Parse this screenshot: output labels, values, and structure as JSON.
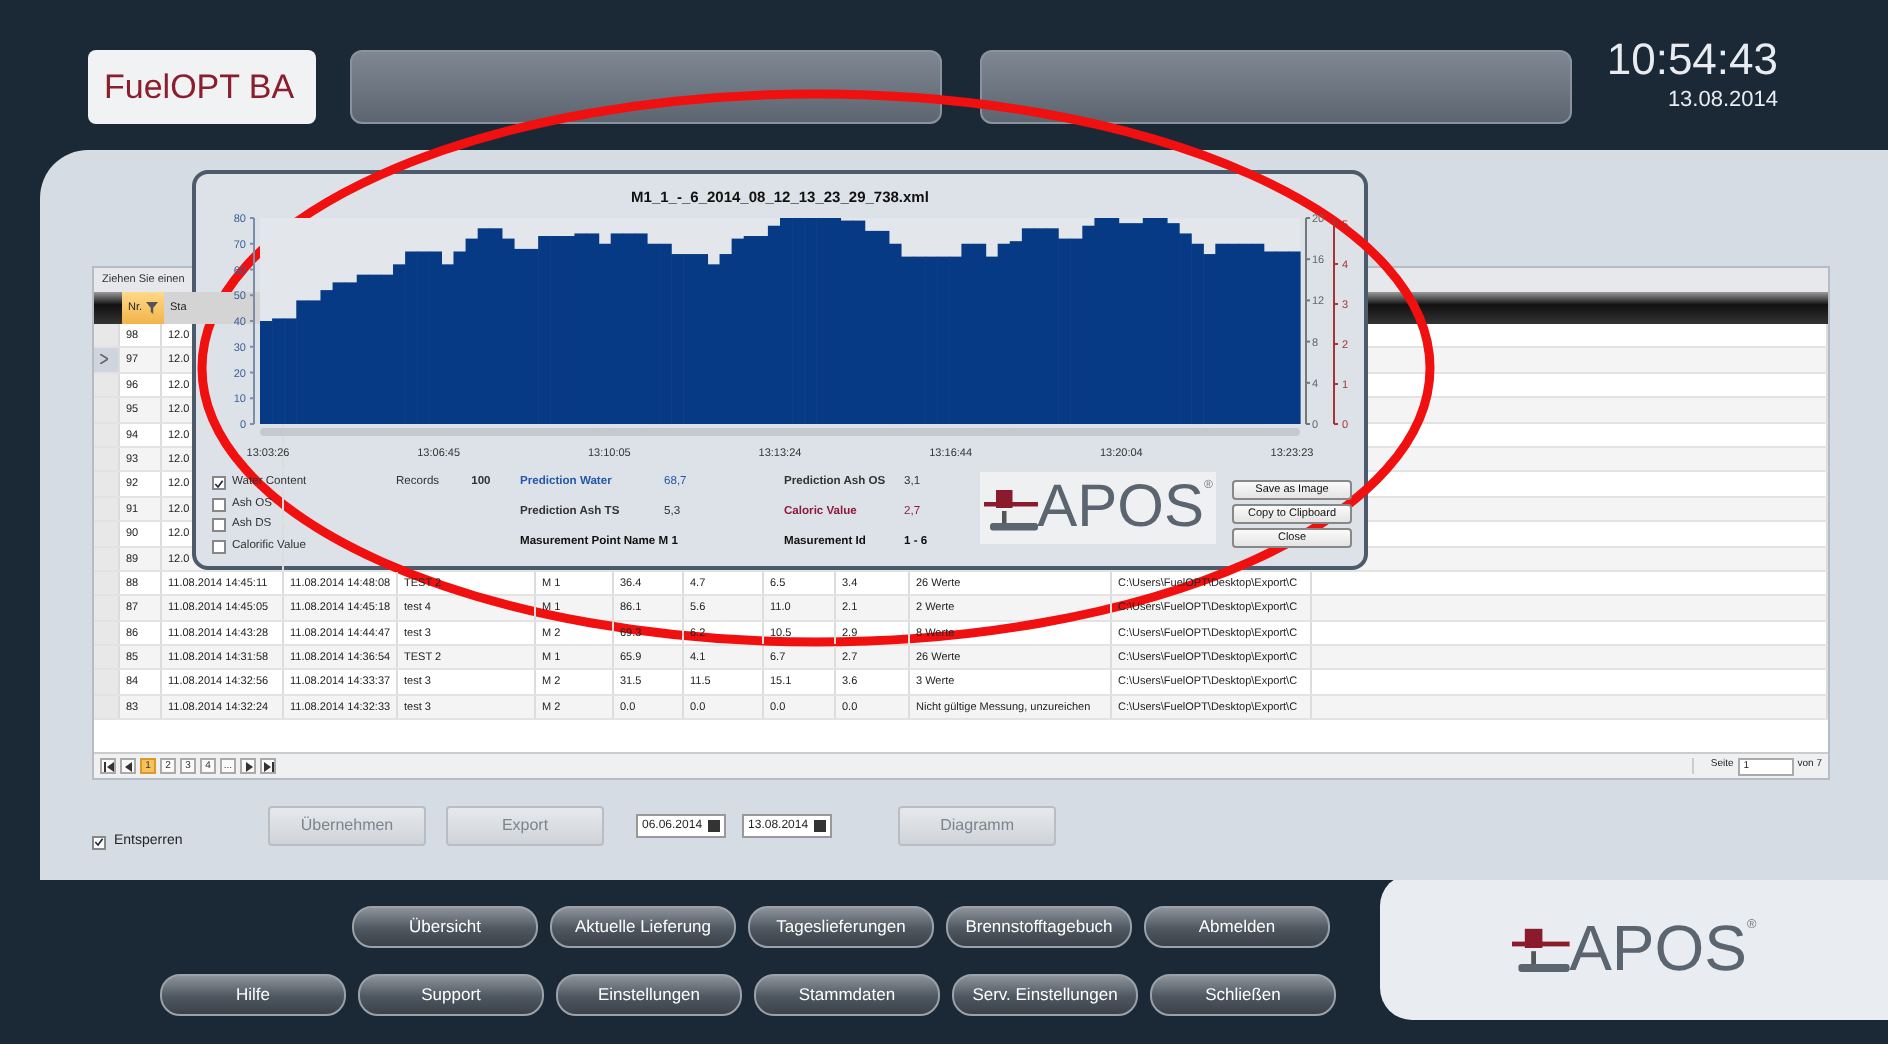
{
  "header": {
    "logo": "FuelOPT BA",
    "time": "10:54:43",
    "date": "13.08.2014"
  },
  "grid": {
    "group_hint": "Ziehen Sie einen",
    "columns": [
      {
        "label": "Nr.",
        "selected": true
      },
      {
        "label": "Sta",
        "selected": false
      }
    ],
    "rows": [
      {
        "selected": false,
        "cells": [
          "98",
          "12.0"
        ]
      },
      {
        "selected": true,
        "cells": [
          "97",
          "12.0"
        ]
      },
      {
        "selected": false,
        "cells": [
          "96",
          "12.0"
        ]
      },
      {
        "selected": false,
        "cells": [
          "95",
          "12.0"
        ]
      },
      {
        "selected": false,
        "cells": [
          "94",
          "12.0"
        ]
      },
      {
        "selected": false,
        "cells": [
          "93",
          "12.0"
        ]
      },
      {
        "selected": false,
        "cells": [
          "92",
          "12.0"
        ]
      },
      {
        "selected": false,
        "cells": [
          "91",
          "12.0"
        ]
      },
      {
        "selected": false,
        "cells": [
          "90",
          "12.0"
        ]
      },
      {
        "selected": false,
        "cells": [
          "89",
          "12.0"
        ]
      },
      {
        "selected": false,
        "cells": [
          "88",
          "11.08.2014 14:45:11",
          "11.08.2014 14:48:08",
          "TEST 2",
          "M 1",
          "36.4",
          "4.7",
          "6.5",
          "3.4",
          "26 Werte",
          "C:\\Users\\FuelOPT\\Desktop\\Export\\C"
        ]
      },
      {
        "selected": false,
        "cells": [
          "87",
          "11.08.2014 14:45:05",
          "11.08.2014 14:45:18",
          "test 4",
          "M 1",
          "86.1",
          "5.6",
          "11.0",
          "2.1",
          "2 Werte",
          "C:\\Users\\FuelOPT\\Desktop\\Export\\C"
        ]
      },
      {
        "selected": false,
        "cells": [
          "86",
          "11.08.2014 14:43:28",
          "11.08.2014 14:44:47",
          "test 3",
          "M 2",
          "69.3",
          "6.2",
          "10.5",
          "2.9",
          "8 Werte",
          "C:\\Users\\FuelOPT\\Desktop\\Export\\C"
        ]
      },
      {
        "selected": false,
        "cells": [
          "85",
          "11.08.2014 14:31:58",
          "11.08.2014 14:36:54",
          "TEST 2",
          "M 1",
          "65.9",
          "4.1",
          "6.7",
          "2.7",
          "26 Werte",
          "C:\\Users\\FuelOPT\\Desktop\\Export\\C"
        ]
      },
      {
        "selected": false,
        "cells": [
          "84",
          "11.08.2014 14:32:56",
          "11.08.2014 14:33:37",
          "test 3",
          "M 2",
          "31.5",
          "11.5",
          "15.1",
          "3.6",
          "3 Werte",
          "C:\\Users\\FuelOPT\\Desktop\\Export\\C"
        ]
      },
      {
        "selected": false,
        "cells": [
          "83",
          "11.08.2014 14:32:24",
          "11.08.2014 14:32:33",
          "test 3",
          "M 2",
          "0.0",
          "0.0",
          "0.0",
          "0.0",
          "Nicht gültige Messung, unzureichen",
          "C:\\Users\\FuelOPT\\Desktop\\Export\\C"
        ]
      }
    ]
  },
  "pager": {
    "pages": [
      {
        "label": "1",
        "selected": true
      },
      {
        "label": "2",
        "selected": false
      },
      {
        "label": "3",
        "selected": false
      },
      {
        "label": "4",
        "selected": false
      },
      {
        "label": "...",
        "selected": false
      }
    ],
    "page_label": "Seite",
    "page_value": "1",
    "page_count": "von 7"
  },
  "controls": {
    "unlock": {
      "label": "Entsperren",
      "checked": true
    },
    "buttons": [
      {
        "label": "Übernehmen",
        "disabled": true
      },
      {
        "label": "Export",
        "disabled": true
      }
    ],
    "dates": [
      "06.06.2014",
      "13.08.2014"
    ],
    "diagram_button": {
      "label": "Diagramm",
      "disabled": true
    }
  },
  "dialog": {
    "title": "M1_1_-_6_2014_08_12_13_23_29_738.xml",
    "chart_data": {
      "type": "bar",
      "ylim": [
        0,
        80
      ],
      "yticks": [
        0,
        10,
        20,
        30,
        40,
        50,
        60,
        70,
        80
      ],
      "series": [
        {
          "color": "#063a84",
          "values": [
            40,
            41,
            41,
            48,
            48,
            52,
            55,
            55,
            58,
            58,
            58,
            62,
            67,
            67,
            67,
            62,
            67,
            72,
            76,
            76,
            72,
            68,
            68,
            73,
            73,
            73,
            74,
            74,
            70,
            74,
            74,
            74,
            70,
            70,
            66,
            66,
            66,
            62,
            66,
            72,
            73,
            73,
            77,
            80,
            80,
            80,
            80,
            80,
            79,
            79,
            75,
            75,
            70,
            65,
            65,
            65,
            65,
            65,
            70,
            70,
            65,
            70,
            71,
            76,
            76,
            76,
            72,
            72,
            77,
            80,
            80,
            78,
            78,
            80,
            80,
            78,
            74,
            70,
            66,
            70,
            70,
            70,
            70,
            67,
            67,
            67
          ]
        }
      ]
    },
    "time_labels": [
      "13:03:26",
      "13:06:45",
      "13:10:05",
      "13:13:24",
      "13:16:44",
      "13:20:04",
      "13:23:23"
    ],
    "right_ticks": [
      "20",
      "16",
      "12",
      "8",
      "4",
      "0"
    ],
    "right_ticks_2": [
      "5",
      "4",
      "3",
      "2",
      "1",
      "0"
    ],
    "series_options": [
      {
        "label": "Water Content",
        "checked": true
      },
      {
        "label": "Ash OS",
        "checked": false
      },
      {
        "label": "Ash DS",
        "checked": false
      },
      {
        "label": "Calorific Value",
        "checked": false
      }
    ],
    "records_label": "Records",
    "records": "100",
    "predictions": [
      {
        "label": "Prediction Water",
        "value": "68,7",
        "kind": "water"
      },
      {
        "label": "Prediction Ash TS",
        "value": "5,3",
        "kind": "plain"
      },
      {
        "label": "Prediction Ash OS",
        "value": "3,1",
        "kind": "plain"
      },
      {
        "label": "Caloric Value",
        "value": "2,7",
        "kind": "caloric"
      }
    ],
    "point_name": "Masurement Point Name M 1",
    "measurement_id_label": "Masurement Id",
    "measurement_id": "1 - 6",
    "logo": "APOS",
    "logo_mark": "®",
    "buttons": [
      "Save as Image",
      "Copy to Clipboard",
      "Close"
    ]
  },
  "nav": {
    "row_1": [
      "Übersicht",
      "Aktuelle Lieferung",
      "Tageslieferungen",
      "Brennstofftagebuch",
      "Abmelden"
    ],
    "row_2": [
      "Hilfe",
      "Support",
      "Einstellungen",
      "Stammdaten",
      "Serv. Einstellungen",
      "Schließen"
    ]
  },
  "brand": {
    "logo": "APOS",
    "mark": "®"
  }
}
